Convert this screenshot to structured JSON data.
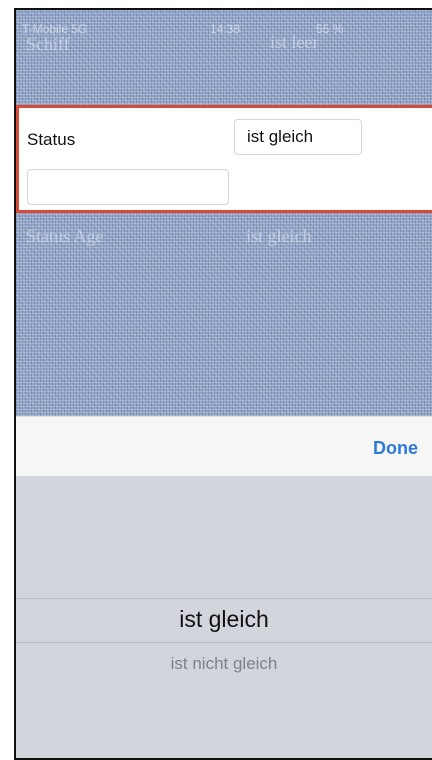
{
  "status_bar": {
    "carrier": "T-Mobile 5G",
    "time": "14:38",
    "battery": "55 %"
  },
  "background_rows": {
    "row1_label": "Schiff",
    "row1_value": "ist leer",
    "row3_label": "Status Age",
    "row3_value": "ist gleich"
  },
  "filter_row": {
    "label": "Status",
    "operator": "ist gleich",
    "value": ""
  },
  "toolbar": {
    "done_label": "Done"
  },
  "picker": {
    "selected": "ist gleich",
    "next": "ist nicht gleich"
  },
  "colors": {
    "highlight_border": "#d64a36",
    "done_blue": "#2f79d6",
    "picker_bg": "#d2d5db"
  }
}
